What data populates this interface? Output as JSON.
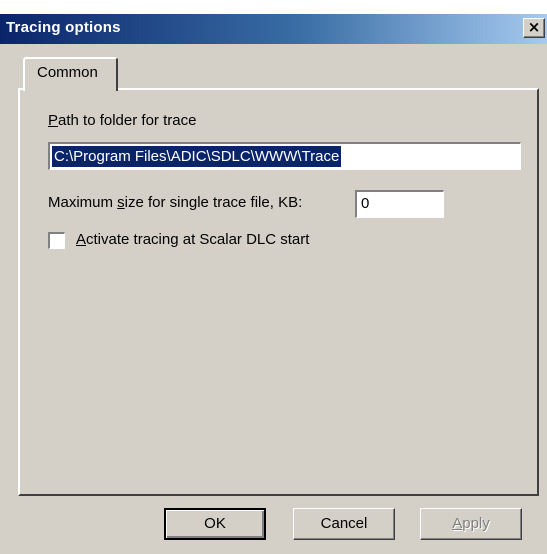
{
  "window": {
    "title": "Tracing options",
    "close_glyph": "×"
  },
  "tabs": [
    {
      "label": "Common",
      "selected": true
    }
  ],
  "common": {
    "path_label": "Path to folder for trace",
    "path_value": "C:\\Program Files\\ADIC\\SDLC\\WWW\\Trace",
    "size_label": "Maximum size for single trace file, KB:",
    "size_value": "0",
    "activate_label": "Activate tracing at Scalar DLC start",
    "activate_checked": false
  },
  "buttons": {
    "ok": "OK",
    "cancel": "Cancel",
    "apply": "Apply",
    "apply_enabled": false
  },
  "colors": {
    "face": "#d4d0c8",
    "title_start": "#0a246a",
    "title_end": "#a6caf0",
    "selection": "#0a246a"
  }
}
